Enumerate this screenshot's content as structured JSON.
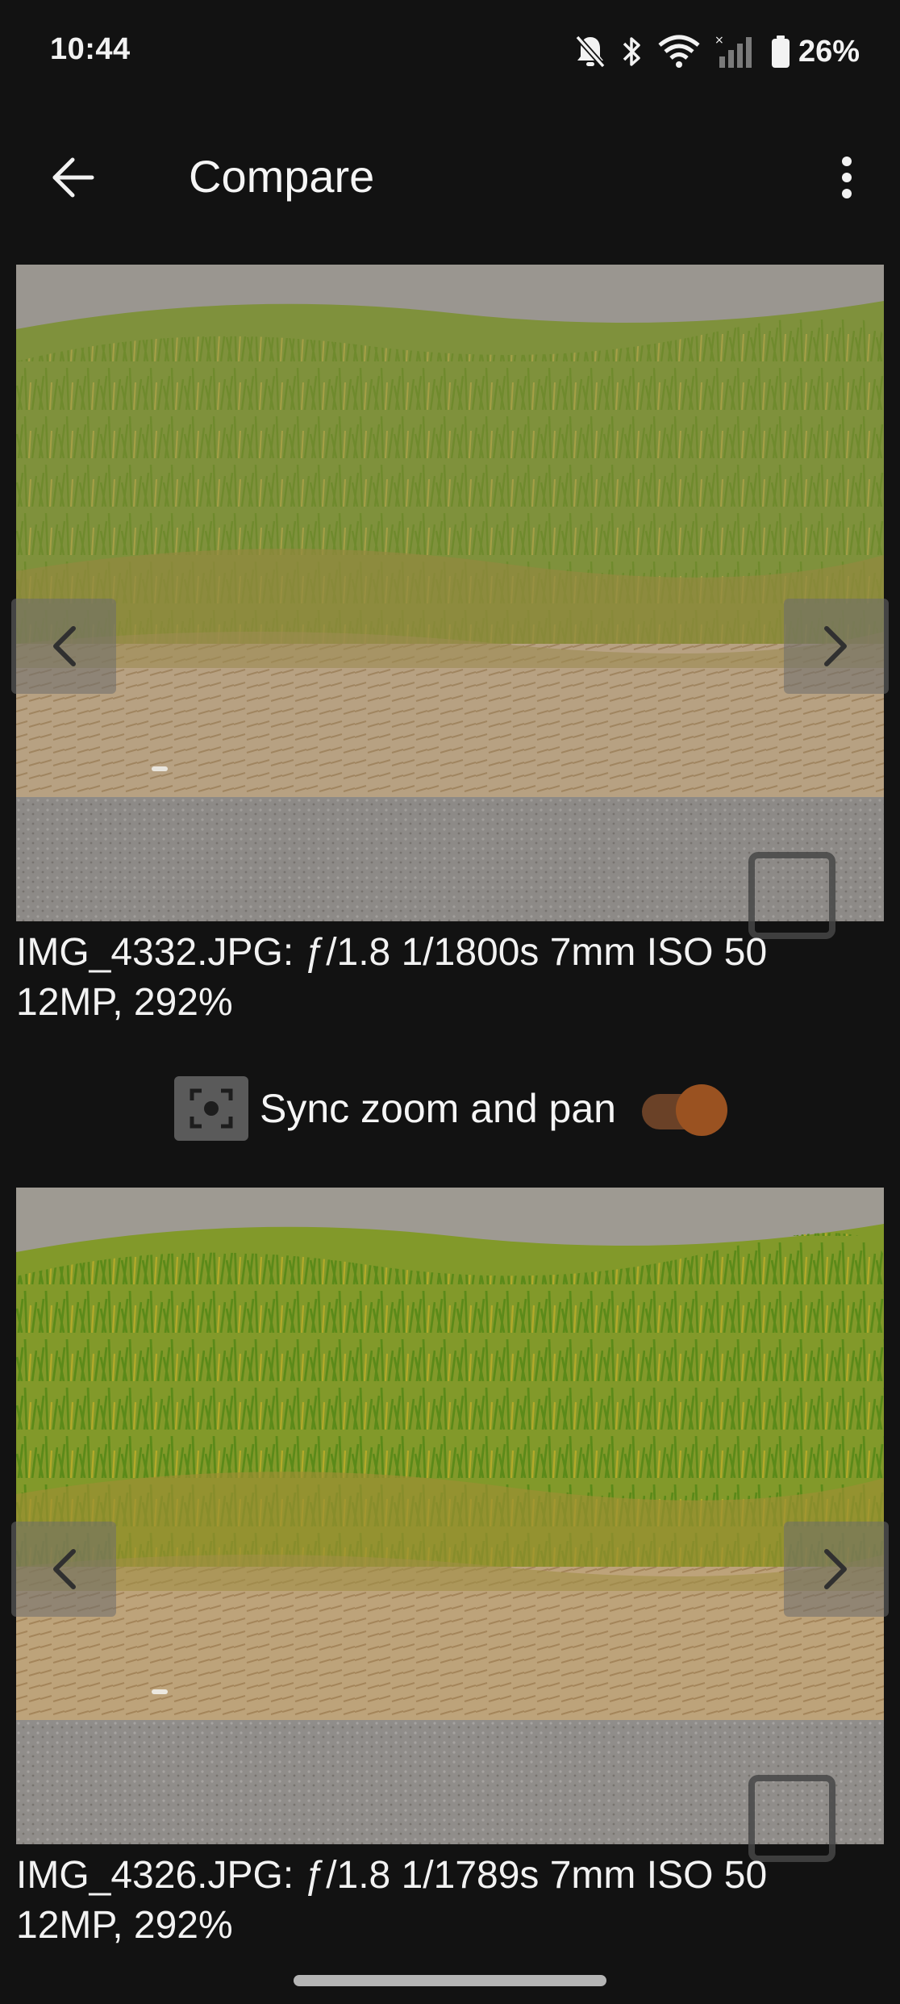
{
  "status_bar": {
    "time": "10:44",
    "battery": "26%",
    "icons": [
      "bell-off-icon",
      "bluetooth-icon",
      "wifi-icon",
      "cellular-signal-icon",
      "battery-icon"
    ]
  },
  "app_bar": {
    "title": "Compare",
    "back_icon": "arrow-back-icon",
    "menu_icon": "more-vert-icon"
  },
  "photos": [
    {
      "caption_line1": "IMG_4332.JPG: ƒ/1.8 1/1800s 7mm ISO 50",
      "caption_line2": "12MP, 292%"
    },
    {
      "caption_line1": "IMG_4326.JPG: ƒ/1.8 1/1789s 7mm ISO 50",
      "caption_line2": "12MP, 292%"
    }
  ],
  "sync": {
    "label": "Sync zoom and pan",
    "enabled": true,
    "icon": "focus-frame-icon"
  },
  "colors": {
    "background": "#121212",
    "accent": "#9a5221",
    "accent_track": "#6a4127"
  }
}
